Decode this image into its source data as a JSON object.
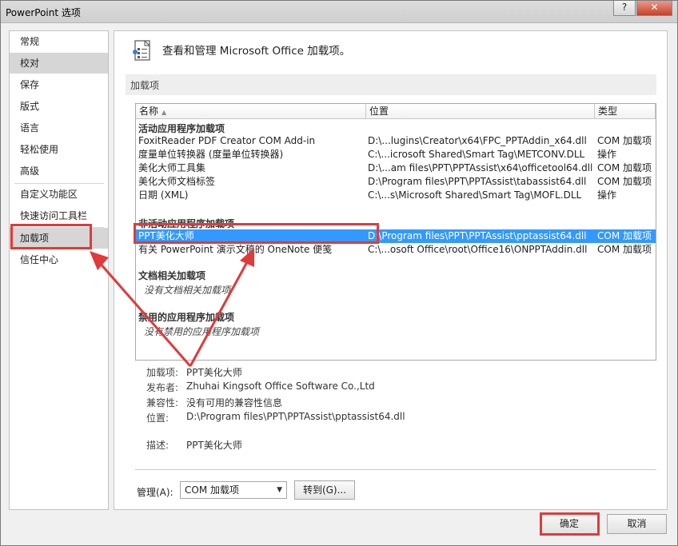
{
  "window": {
    "title": "PowerPoint 选项",
    "help_label": "?",
    "close_label": "✕"
  },
  "sidebar": {
    "items": [
      {
        "label": "常规"
      },
      {
        "label": "校对"
      },
      {
        "label": "保存"
      },
      {
        "label": "版式"
      },
      {
        "label": "语言"
      },
      {
        "label": "轻松使用"
      },
      {
        "label": "高级"
      },
      {
        "label": "自定义功能区"
      },
      {
        "label": "快速访问工具栏"
      },
      {
        "label": "加载项"
      },
      {
        "label": "信任中心"
      }
    ]
  },
  "main": {
    "header": "查看和管理 Microsoft Office 加载项。",
    "section_title": "加载项",
    "columns": {
      "name": "名称",
      "location": "位置",
      "type": "类型"
    },
    "groups": {
      "active": "活动应用程序加载项",
      "inactive": "非活动应用程序加载项",
      "document": "文档相关加载项",
      "disabled": "禁用的应用程序加载项"
    },
    "active_rows": [
      {
        "name": "FoxitReader PDF Creator COM Add-in",
        "location": "D:\\...lugins\\Creator\\x64\\FPC_PPTAddin_x64.dll",
        "type": "COM 加载项"
      },
      {
        "name": "度量单位转换器 (度量单位转换器)",
        "location": "C:\\...icrosoft Shared\\Smart Tag\\METCONV.DLL",
        "type": "操作"
      },
      {
        "name": "美化大师工具集",
        "location": "D:\\...am files\\PPT\\PPTAssist\\x64\\officetool64.dll",
        "type": "COM 加载项"
      },
      {
        "name": "美化大师文档标签",
        "location": "D:\\Program files\\PPT\\PPTAssist\\tabassist64.dll",
        "type": "COM 加载项"
      },
      {
        "name": "日期 (XML)",
        "location": "C:\\...s\\Microsoft Shared\\Smart Tag\\MOFL.DLL",
        "type": "操作"
      }
    ],
    "inactive_rows": [
      {
        "name": "PPT美化大师",
        "location": "D:\\Program files\\PPT\\PPTAssist\\pptassist64.dll",
        "type": "COM 加载项"
      },
      {
        "name": "有关 PowerPoint 演示文稿的 OneNote 便笺",
        "location": "C:\\...osoft Office\\root\\Office16\\ONPPTAddin.dll",
        "type": "COM 加载项"
      }
    ],
    "document_empty": "没有文档相关加载项",
    "disabled_empty": "没有禁用的应用程序加载项",
    "details": {
      "addin_label": "加载项:",
      "addin_value": "PPT美化大师",
      "publisher_label": "发布者:",
      "publisher_value": "Zhuhai Kingsoft Office Software Co.,Ltd",
      "compat_label": "兼容性:",
      "compat_value": "没有可用的兼容性信息",
      "location_label": "位置:",
      "location_value": "D:\\Program files\\PPT\\PPTAssist\\pptassist64.dll",
      "desc_label": "描述:",
      "desc_value": "PPT美化大师"
    },
    "manage": {
      "label": "管理(A):",
      "selected": "COM 加载项",
      "goto_label": "转到(G)..."
    }
  },
  "footer": {
    "ok_label": "确定",
    "cancel_label": "取消"
  },
  "colors": {
    "selection": "#3399ff",
    "annotation": "#e03a3a"
  }
}
